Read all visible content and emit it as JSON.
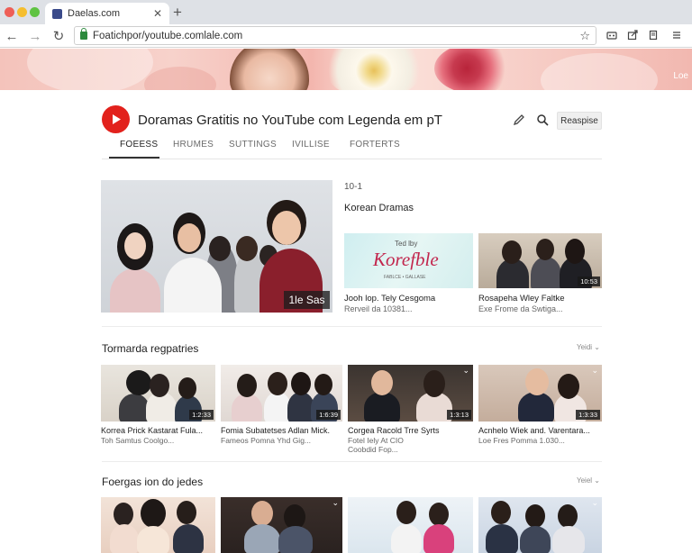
{
  "browser": {
    "tab_title": "Daelas.com",
    "tab_close": "✕",
    "new_tab": "+",
    "url": "Foatichpor/youtube.comlale.com",
    "back": "←",
    "forward": "→",
    "reload": "↻",
    "star": "☆"
  },
  "banner": {
    "text": "Loe"
  },
  "channel": {
    "title": "Doramas Gratitis no YouTube com Legenda em pT",
    "subscribe_label": "Reaspise",
    "tabs": [
      "FOEESS",
      "HRUMES",
      "SUTTINGS",
      "IVILLISE",
      "FORTERTS"
    ]
  },
  "featured": {
    "badge": "1le Sas",
    "side_count": "10-1",
    "side_title": "Korean Dramas",
    "side_videos": [
      {
        "thumb_text": "Korefble",
        "thumb_top": "Ted lby",
        "thumb_small": "FABLCE  •  GALLASE",
        "title": "Jooh lop. Tely Cesgoma",
        "meta": "Rerveil da 10381..."
      },
      {
        "duration": "10:53",
        "title": "Rosapeha Wley Faltke",
        "meta": "Exe Frome da Swtiga..."
      }
    ]
  },
  "sections": [
    {
      "title": "Tormarda regpatries",
      "more": "Yeidi",
      "cards": [
        {
          "duration": "1:2:33",
          "title": "Korrea Prick Kastarat Fula...",
          "meta": "Toh Samtus Coolgo..."
        },
        {
          "duration": "1:6:39",
          "title": "Fomia Subatetses Adlan Mick.",
          "meta": "Fameos Pomna Yhd Gig..."
        },
        {
          "duration": "1:3:13",
          "title": "Corgea Racold Trre Syrts",
          "meta": "Fotel Iely At CIO",
          "meta2": "Coobdid Fop..."
        },
        {
          "duration": "1:3:33",
          "title": "Acnhelo Wiek and. Varentara...",
          "meta": "Loe Fres Pomma 1.030..."
        }
      ]
    },
    {
      "title": "Foergas ion do jedes",
      "more": "Yeiel",
      "cards": [
        {},
        {},
        {},
        {}
      ]
    }
  ],
  "colors": {
    "accent": "#e2211c",
    "tab_underline": "#333333"
  },
  "icons": [
    "back-arrow-icon",
    "forward-arrow-icon",
    "reload-icon",
    "lock-icon",
    "star-icon",
    "pencil-icon",
    "search-icon",
    "play-icon",
    "chevron-down-icon"
  ]
}
